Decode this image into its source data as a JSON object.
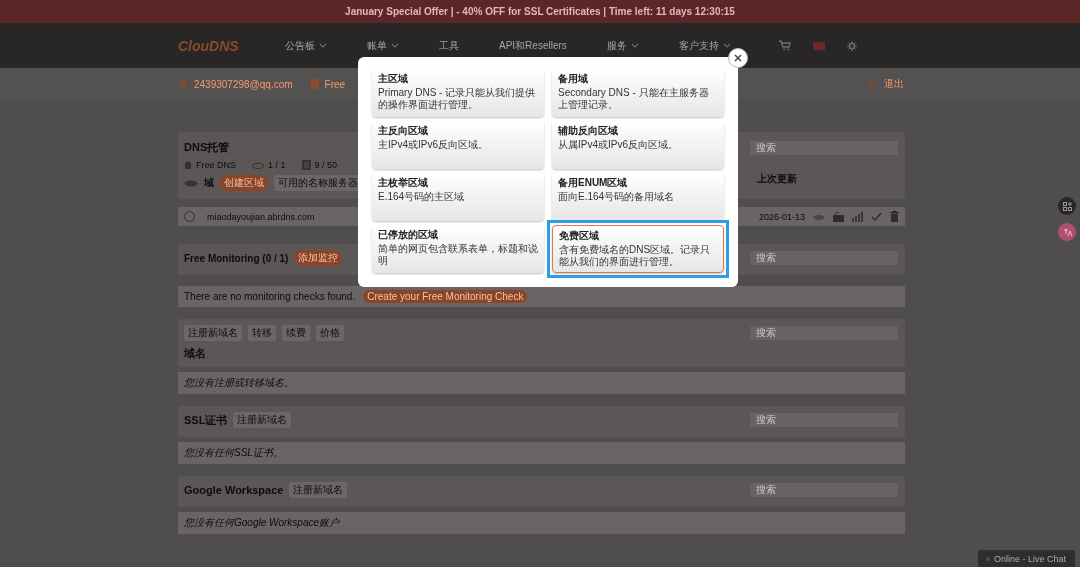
{
  "promo_banner": "January Special Offer | - 40% OFF for SSL Certificates | Time left: 11 days 12:30:15",
  "header": {
    "logo": "ClouDNS",
    "nav": [
      {
        "label": "公告板",
        "dropdown": true
      },
      {
        "label": "账单",
        "dropdown": true
      },
      {
        "label": "工具",
        "dropdown": false
      },
      {
        "label": "API和Resellers",
        "dropdown": false
      },
      {
        "label": "服务",
        "dropdown": true
      },
      {
        "label": "客户支持",
        "dropdown": true
      }
    ]
  },
  "user_bar": {
    "email": "2439307298@qq.com",
    "plan": "Free",
    "logout": "退出"
  },
  "dns_hosting": {
    "title": "DNS托管",
    "stats": [
      {
        "kind": "plan",
        "text": "Free DNS"
      },
      {
        "kind": "zones",
        "text": "1 / 1"
      },
      {
        "kind": "records",
        "text": "9 / 50"
      }
    ],
    "search_placeholder": "搜索",
    "domain_label": "域",
    "create_button": "创建区域",
    "nameservers_button": "可用的名称服务器",
    "last_updated_header": "上次更新",
    "zones": [
      {
        "name": "miaodayoujian.abrdns.com",
        "updated": "2026-01-13"
      }
    ]
  },
  "monitoring": {
    "title": "Free Monitoring (0 / 1)",
    "add_button": "添加监控",
    "search_placeholder": "搜索",
    "empty_text": "There are no monitoring checks found.",
    "create_button": "Create your Free Monitoring Check"
  },
  "domains": {
    "tabs": [
      "注册新域名",
      "转移",
      "续费",
      "价格"
    ],
    "search_placeholder": "搜索",
    "title": "域名",
    "empty_text": "您没有注册或转移域名。"
  },
  "ssl": {
    "title": "SSL证书",
    "button": "注册新域名",
    "search_placeholder": "搜索",
    "empty_text": "您没有任何SSL证书。"
  },
  "workspace": {
    "title": "Google Workspace",
    "button": "注册新域名",
    "search_placeholder": "搜索",
    "empty_text": "您没有任何Google Workspace账户"
  },
  "live_chat": "Online - Live Chat",
  "modal": {
    "options": [
      {
        "title": "主区域",
        "description": "Primary DNS - 记录只能从我们提供的操作界面进行管理。",
        "selected": false
      },
      {
        "title": "备用域",
        "description": "Secondary DNS - 只能在主服务器上管理记录。",
        "selected": false
      },
      {
        "title": "主反向区域",
        "description": "主IPv4或IPv6反向区域。",
        "selected": false
      },
      {
        "title": "辅助反向区域",
        "description": "从属IPv4或IPv6反向区域。",
        "selected": false
      },
      {
        "title": "主枚举区域",
        "description": "E.164号码的主区域",
        "selected": false
      },
      {
        "title": "备用ENUM区域",
        "description": "面向E.164号码的备用域名",
        "selected": false
      },
      {
        "title": "已停放的区域",
        "description": "简单的网页包含联系表单，标题和说明",
        "selected": false
      },
      {
        "title": "免费区域",
        "description": "含有免费域名的DNS区域。记录只能从我们的界面进行管理。",
        "selected": true
      }
    ]
  }
}
